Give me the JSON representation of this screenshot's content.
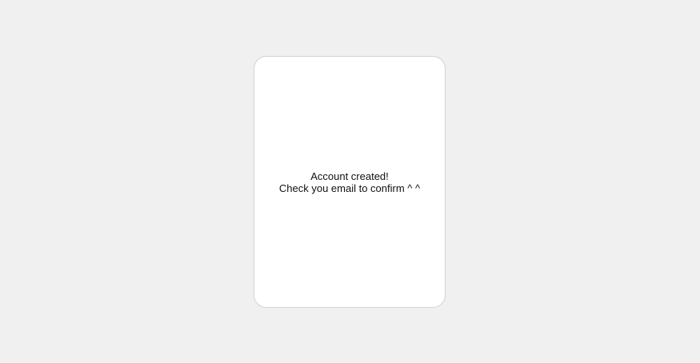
{
  "card": {
    "title": "Account created!",
    "subtitle": "Check you email to confirm ^ ^"
  },
  "colors": {
    "page_background": "#f0f0f0",
    "card_background": "#ffffff",
    "card_border": "#d3d3d3",
    "text": "#111111"
  }
}
